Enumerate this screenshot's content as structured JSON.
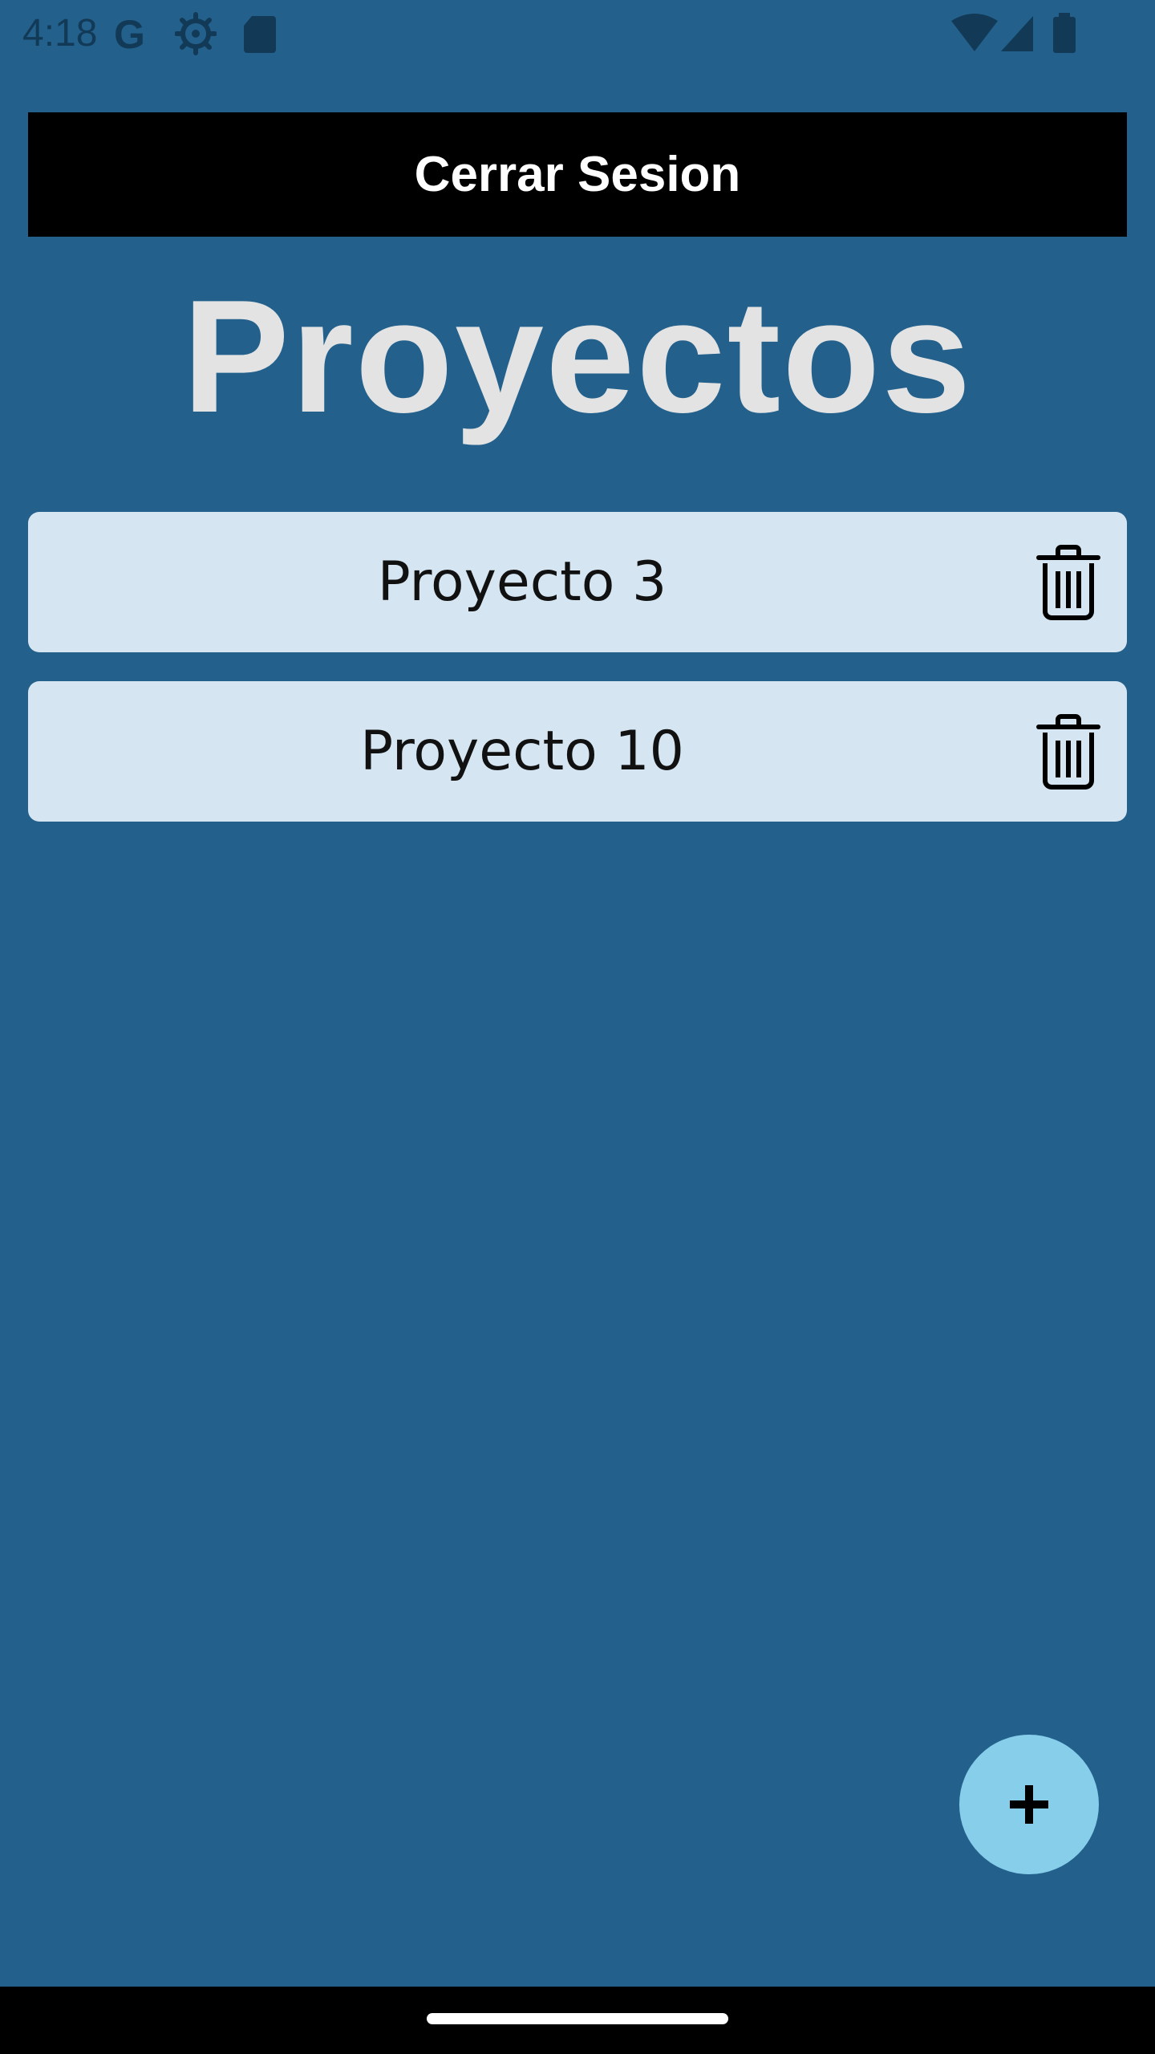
{
  "status_bar": {
    "time": "4:18",
    "icons": [
      "google-icon",
      "settings-gear-icon",
      "sd-card-icon",
      "wifi-icon",
      "cell-signal-icon",
      "battery-icon"
    ]
  },
  "header": {
    "logout_label": "Cerrar Sesion"
  },
  "page": {
    "title": "Proyectos"
  },
  "projects": [
    {
      "name": "Proyecto 3",
      "action_icon": "trash-icon"
    },
    {
      "name": "Proyecto 10",
      "action_icon": "trash-icon"
    }
  ],
  "fab": {
    "icon": "plus-icon"
  },
  "colors": {
    "background": "#23618c",
    "logout_bg": "#000000",
    "title": "#e3e3e3",
    "card_bg": "#d5e6f2",
    "fab_bg": "#87ceeb",
    "status_icons": "#123a57"
  }
}
